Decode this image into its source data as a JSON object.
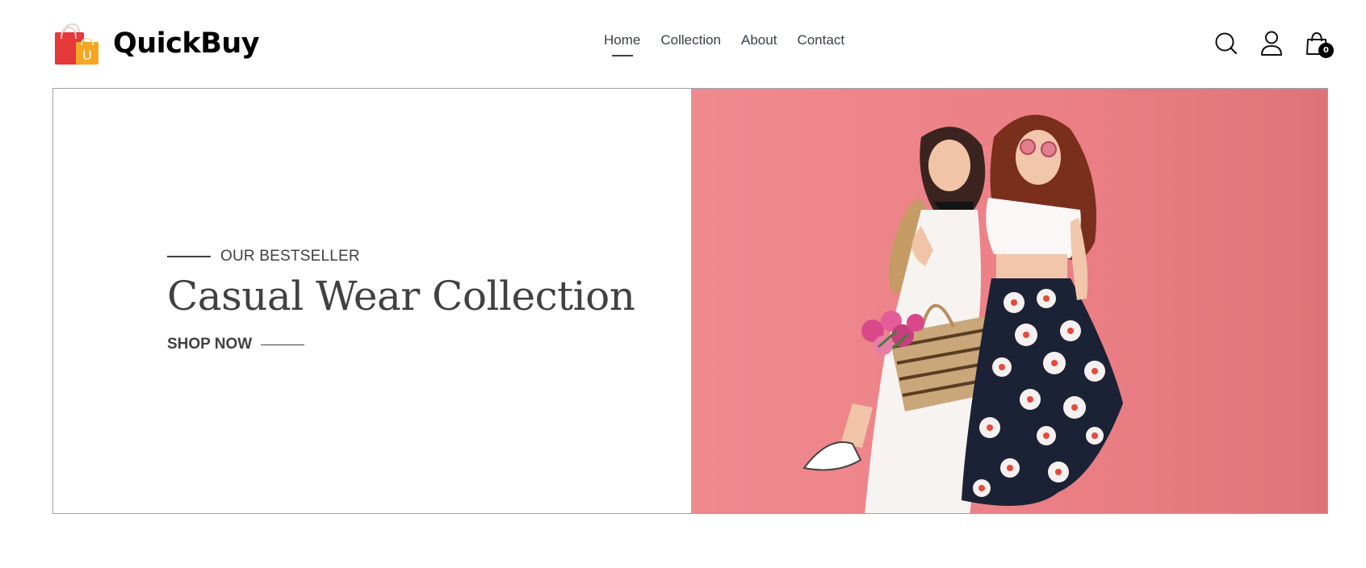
{
  "brand": {
    "name": "QuickBuy",
    "logo_letter": "U"
  },
  "nav": {
    "items": [
      {
        "label": "Home",
        "active": true
      },
      {
        "label": "Collection",
        "active": false
      },
      {
        "label": "About",
        "active": false
      },
      {
        "label": "Contact",
        "active": false
      }
    ]
  },
  "header_icons": {
    "search": "search-icon",
    "profile": "user-icon",
    "cart": "shopping-bag-icon",
    "cart_count": "0"
  },
  "hero": {
    "eyebrow": "OUR BESTSELLER",
    "title": "Casual Wear Collection",
    "cta_label": "SHOP NOW",
    "image": "two-women-smiling-pink-background"
  },
  "colors": {
    "hero_bg": "#ec8589",
    "text": "#414141",
    "logo_red": "#e53935",
    "logo_yellow": "#f5a623"
  }
}
